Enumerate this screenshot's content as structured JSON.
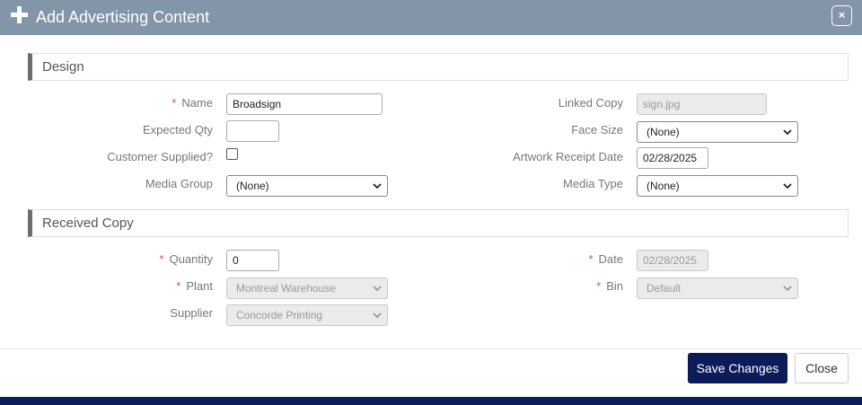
{
  "dialog": {
    "title": "Add Advertising Content",
    "close_glyph": "×",
    "save_label": "Save Changes",
    "close_label": "Close"
  },
  "design": {
    "heading": "Design",
    "name": {
      "label": "Name",
      "value": "Broadsign",
      "required": true
    },
    "expected_qty": {
      "label": "Expected Qty",
      "value": ""
    },
    "customer_supplied": {
      "label": "Customer Supplied?",
      "checked": false
    },
    "media_group": {
      "label": "Media Group",
      "value": "(None)"
    },
    "linked_copy": {
      "label": "Linked Copy",
      "value": "sign.jpg",
      "disabled": true
    },
    "face_size": {
      "label": "Face Size",
      "value": "(None)"
    },
    "artwork_receipt_date": {
      "label": "Artwork Receipt Date",
      "value": "02/28/2025"
    },
    "media_type": {
      "label": "Media Type",
      "value": "(None)"
    }
  },
  "received_copy": {
    "heading": "Received Copy",
    "quantity": {
      "label": "Quantity",
      "value": "0",
      "required": true
    },
    "plant": {
      "label": "Plant",
      "value": "Montreal Warehouse",
      "required": true,
      "disabled": true
    },
    "supplier": {
      "label": "Supplier",
      "value": "Concorde Printing",
      "disabled": true
    },
    "date": {
      "label": "Date",
      "value": "02/28/2025",
      "required": true,
      "disabled": true
    },
    "bin": {
      "label": "Bin",
      "value": "Default",
      "required": true,
      "disabled": true
    }
  },
  "required_marker": "*",
  "colors": {
    "titlebar": "#8395a9",
    "primary_button": "#0c1c5b",
    "required": "#d9534f"
  }
}
